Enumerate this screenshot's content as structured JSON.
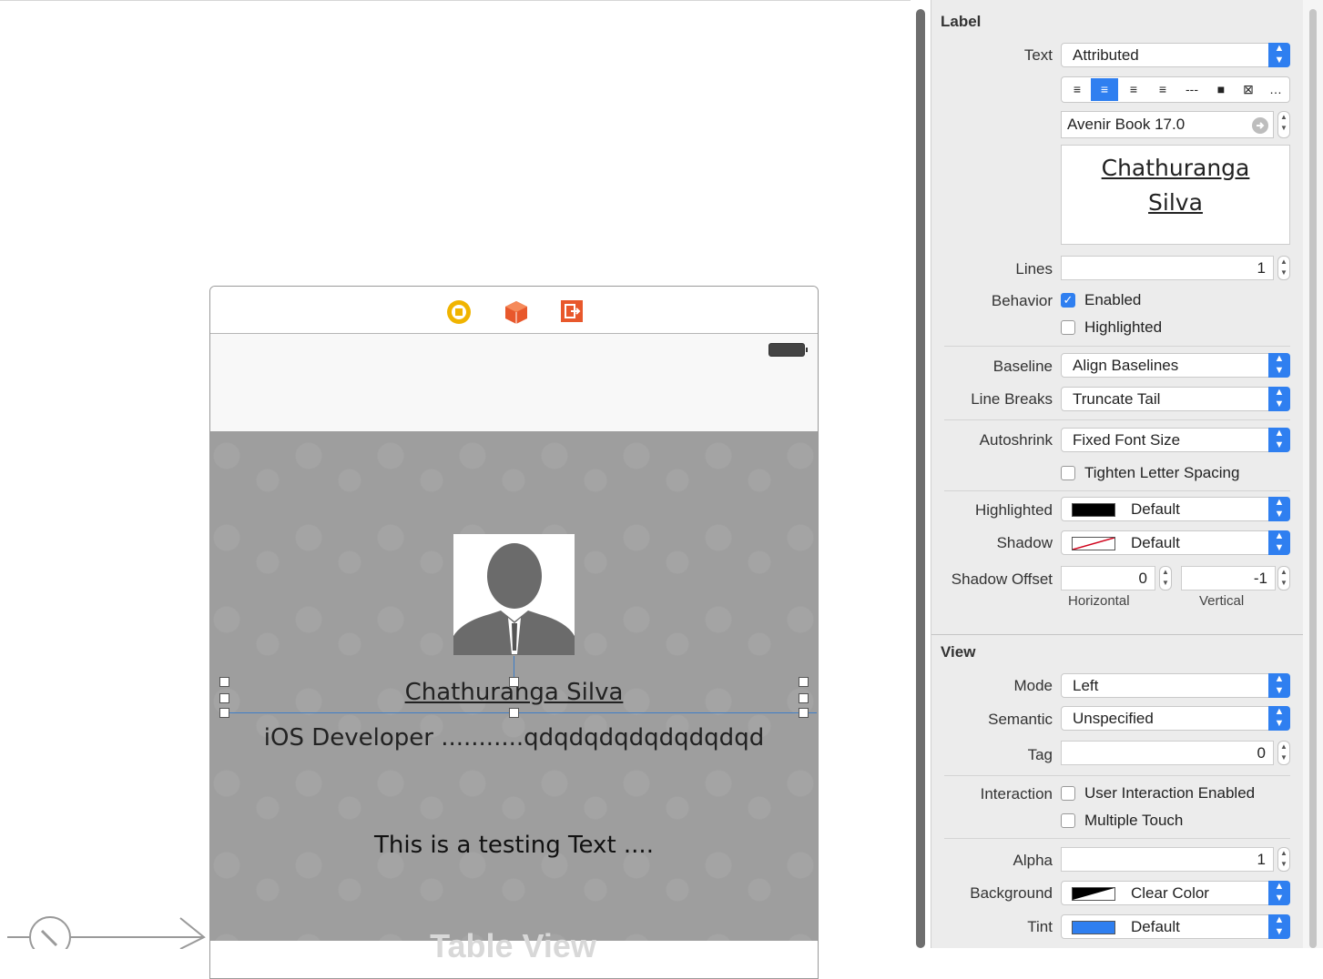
{
  "canvas": {
    "scene_icons": [
      "view-controller-icon",
      "first-responder-icon",
      "exit-icon"
    ],
    "profile": {
      "name": "Chathuranga Silva",
      "subtitle": "iOS Developer ...........qdqdqdqdqdqdqdqd",
      "testing_text": "This is a testing Text ...."
    },
    "partial_table_label": "Table View"
  },
  "inspector": {
    "label_section": {
      "title": "Label",
      "text_label": "Text",
      "text_value": "Attributed",
      "alignment_options": [
        "≡",
        "≡",
        "≡",
        "≡",
        "---",
        "■",
        "⊠",
        "…"
      ],
      "font_value": "Avenir Book 17.0",
      "preview_line1": "Chathuranga",
      "preview_line2": "Silva",
      "lines_label": "Lines",
      "lines_value": "1",
      "behavior_label": "Behavior",
      "enabled_label": "Enabled",
      "highlighted_check_label": "Highlighted",
      "baseline_label": "Baseline",
      "baseline_value": "Align Baselines",
      "line_breaks_label": "Line Breaks",
      "line_breaks_value": "Truncate Tail",
      "autoshrink_label": "Autoshrink",
      "autoshrink_value": "Fixed Font Size",
      "tighten_label": "Tighten Letter Spacing",
      "highlighted_label": "Highlighted",
      "highlighted_value": "Default",
      "shadow_label": "Shadow",
      "shadow_value": "Default",
      "shadow_offset_label": "Shadow Offset",
      "shadow_h_value": "0",
      "shadow_v_value": "-1",
      "horizontal_label": "Horizontal",
      "vertical_label": "Vertical"
    },
    "view_section": {
      "title": "View",
      "mode_label": "Mode",
      "mode_value": "Left",
      "semantic_label": "Semantic",
      "semantic_value": "Unspecified",
      "tag_label": "Tag",
      "tag_value": "0",
      "interaction_label": "Interaction",
      "user_interaction_label": "User Interaction Enabled",
      "multiple_touch_label": "Multiple Touch",
      "alpha_label": "Alpha",
      "alpha_value": "1",
      "background_label": "Background",
      "background_value": "Clear Color",
      "tint_label": "Tint",
      "tint_value": "Default"
    }
  },
  "colors": {
    "accent": "#2f7ff0",
    "content_bg": "#9e9e9e",
    "selection": "#3e7ec7",
    "exit_icon": "#e8582c",
    "vc_icon": "#f0b400"
  }
}
